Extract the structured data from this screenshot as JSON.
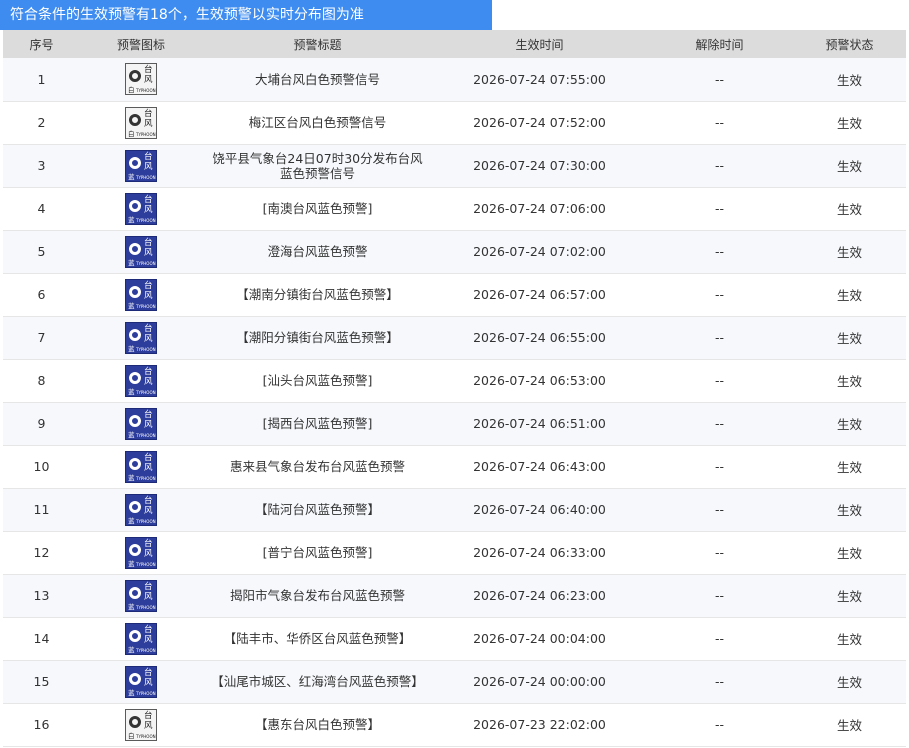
{
  "banner": {
    "text": "符合条件的生效预警有18个，生效预警以实时分布图为准",
    "accent_color": "#3f8cf0"
  },
  "columns": [
    "序号",
    "预警图标",
    "预警标题",
    "生效时间",
    "解除时间",
    "预警状态"
  ],
  "icon_text": {
    "line1": "台",
    "line2": "风",
    "english": "TYPHOON"
  },
  "icon_colors": {
    "blue": "#2d3d9c",
    "white": "#f4f4f4"
  },
  "rows": [
    {
      "no": "1",
      "icon": "typhoon-white-signal-icon",
      "color_label": "白",
      "title": "大埔台风白色预警信号",
      "start": "2026-07-24 07:55:00",
      "end": "--",
      "status": "生效"
    },
    {
      "no": "2",
      "icon": "typhoon-white-signal-icon",
      "color_label": "白",
      "title": "梅江区台风白色预警信号",
      "start": "2026-07-24 07:52:00",
      "end": "--",
      "status": "生效"
    },
    {
      "no": "3",
      "icon": "typhoon-blue-signal-icon",
      "color_label": "蓝",
      "title": "饶平县气象台24日07时30分发布台风蓝色预警信号",
      "start": "2026-07-24 07:30:00",
      "end": "--",
      "status": "生效"
    },
    {
      "no": "4",
      "icon": "typhoon-blue-signal-icon",
      "color_label": "蓝",
      "title": "[南澳台风蓝色预警]",
      "start": "2026-07-24 07:06:00",
      "end": "--",
      "status": "生效"
    },
    {
      "no": "5",
      "icon": "typhoon-blue-signal-icon",
      "color_label": "蓝",
      "title": "澄海台风蓝色预警",
      "start": "2026-07-24 07:02:00",
      "end": "--",
      "status": "生效"
    },
    {
      "no": "6",
      "icon": "typhoon-blue-signal-icon",
      "color_label": "蓝",
      "title": "【潮南分镇街台风蓝色预警】",
      "start": "2026-07-24 06:57:00",
      "end": "--",
      "status": "生效"
    },
    {
      "no": "7",
      "icon": "typhoon-blue-signal-icon",
      "color_label": "蓝",
      "title": "【潮阳分镇街台风蓝色预警】",
      "start": "2026-07-24 06:55:00",
      "end": "--",
      "status": "生效"
    },
    {
      "no": "8",
      "icon": "typhoon-blue-signal-icon",
      "color_label": "蓝",
      "title": "[汕头台风蓝色预警]",
      "start": "2026-07-24 06:53:00",
      "end": "--",
      "status": "生效"
    },
    {
      "no": "9",
      "icon": "typhoon-blue-signal-icon",
      "color_label": "蓝",
      "title": "[揭西台风蓝色预警]",
      "start": "2026-07-24 06:51:00",
      "end": "--",
      "status": "生效"
    },
    {
      "no": "10",
      "icon": "typhoon-blue-signal-icon",
      "color_label": "蓝",
      "title": "惠来县气象台发布台风蓝色预警",
      "start": "2026-07-24 06:43:00",
      "end": "--",
      "status": "生效"
    },
    {
      "no": "11",
      "icon": "typhoon-blue-signal-icon",
      "color_label": "蓝",
      "title": "【陆河台风蓝色预警】",
      "start": "2026-07-24 06:40:00",
      "end": "--",
      "status": "生效"
    },
    {
      "no": "12",
      "icon": "typhoon-blue-signal-icon",
      "color_label": "蓝",
      "title": "[普宁台风蓝色预警]",
      "start": "2026-07-24 06:33:00",
      "end": "--",
      "status": "生效"
    },
    {
      "no": "13",
      "icon": "typhoon-blue-signal-icon",
      "color_label": "蓝",
      "title": "揭阳市气象台发布台风蓝色预警",
      "start": "2026-07-24 06:23:00",
      "end": "--",
      "status": "生效"
    },
    {
      "no": "14",
      "icon": "typhoon-blue-signal-icon",
      "color_label": "蓝",
      "title": "【陆丰市、华侨区台风蓝色预警】",
      "start": "2026-07-24 00:04:00",
      "end": "--",
      "status": "生效"
    },
    {
      "no": "15",
      "icon": "typhoon-blue-signal-icon",
      "color_label": "蓝",
      "title": "【汕尾市城区、红海湾台风蓝色预警】",
      "start": "2026-07-24 00:00:00",
      "end": "--",
      "status": "生效"
    },
    {
      "no": "16",
      "icon": "typhoon-white-signal-icon",
      "color_label": "白",
      "title": "【惠东台风白色预警】",
      "start": "2026-07-23 22:02:00",
      "end": "--",
      "status": "生效"
    }
  ]
}
